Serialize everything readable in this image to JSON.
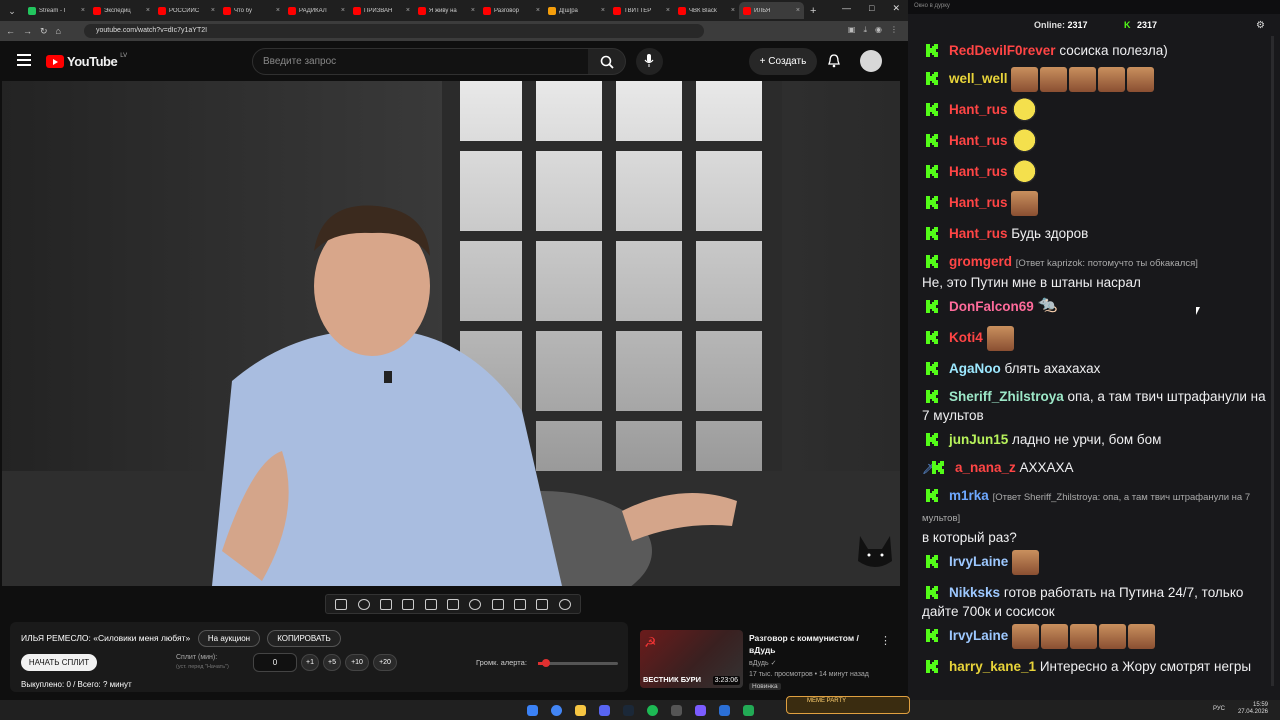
{
  "tabs": [
    {
      "label": "Stream - I",
      "color": "#22c55e",
      "active": false
    },
    {
      "label": "Экспедиц",
      "color": "#ff0000",
      "active": false
    },
    {
      "label": "РОССИЙС",
      "color": "#ff0000",
      "active": false
    },
    {
      "label": "Что бу",
      "color": "#ff0000",
      "active": false
    },
    {
      "label": "РАДИКАЛ",
      "color": "#ff0000",
      "active": false
    },
    {
      "label": "ПРИЗВАН",
      "color": "#ff0000",
      "active": false
    },
    {
      "label": "Я живу на",
      "color": "#ff0000",
      "active": false
    },
    {
      "label": "Разговор",
      "color": "#ff0000",
      "active": false
    },
    {
      "label": "Д[ш]ра",
      "color": "#f59e0b",
      "active": false
    },
    {
      "label": "ТВИТТЕР",
      "color": "#ff0000",
      "active": false
    },
    {
      "label": "ЧВК Black",
      "color": "#ff0000",
      "active": false
    },
    {
      "label": "ИЛЬЯ",
      "color": "#ff0000",
      "active": true
    }
  ],
  "url": "youtube.com/watch?v=dIc7y1aYT2I",
  "yt": {
    "logo_text": "YouTube",
    "region": "LV",
    "search_placeholder": "Введите запрос",
    "create_label": "Создать"
  },
  "panel": {
    "title": "ИЛЬЯ РЕМЕСЛО: «Силовики меня любят»",
    "auction_label": "На аукцион",
    "copy_label": "КОПИРОВАТЬ",
    "start_split_label": "НАЧАТЬ СПЛИТ",
    "split_label": "Сплит (мин):",
    "split_sub": "(уст. перед \"Начать\")",
    "split_value": "0",
    "inc": [
      "+1",
      "+5",
      "+10",
      "+20"
    ],
    "volume_label": "Громк. алерта:",
    "volume_level": 0.1,
    "sold_text": "Выкуплено: 0 / Всего: ? минут"
  },
  "recommend": {
    "title": "Разговор с коммунистом / вДудь",
    "channel": "вДудь",
    "stats": "17 тыс. просмотров • 14 минут назад",
    "badge": "Новинка",
    "thumb_caption": "ВЕСТНИК БУРИ",
    "duration": "3:23:06"
  },
  "chat": {
    "window_title": "Окно в дурку",
    "online_label": "Online:",
    "online_count": "2317",
    "viewer_count": "2317",
    "messages": [
      {
        "user": "RedDevilF0rever",
        "color": "#ff4545",
        "text": "сосиска полезла)",
        "emotes": []
      },
      {
        "user": "well_well",
        "color": "#e8d43a",
        "text": "",
        "emotes": [
          "face",
          "face",
          "face",
          "face",
          "face"
        ]
      },
      {
        "user": "Hant_rus",
        "color": "#ff4545",
        "text": "",
        "emotes": [
          "bee"
        ]
      },
      {
        "user": "Hant_rus",
        "color": "#ff4545",
        "text": "",
        "emotes": [
          "bee"
        ]
      },
      {
        "user": "Hant_rus",
        "color": "#ff4545",
        "text": "",
        "emotes": [
          "bee"
        ]
      },
      {
        "user": "Hant_rus",
        "color": "#ff4545",
        "text": "",
        "emotes": [
          "face"
        ]
      },
      {
        "user": "Hant_rus",
        "color": "#ff4545",
        "text": "Будь здоров",
        "emotes": []
      },
      {
        "user": "gromgerd",
        "color": "#ff4545",
        "reply": "[Ответ kaprizok: потомучто ты обкакался]",
        "text": "Не, это Путин мне в штаны насрал",
        "emotes": []
      },
      {
        "user": "DonFalcon69",
        "color": "#ff6b9b",
        "text": "",
        "emotes": [
          "mouse"
        ]
      },
      {
        "user": "Koti4",
        "color": "#ff4545",
        "text": "",
        "emotes": [
          "face"
        ]
      },
      {
        "user": "AgaNoo",
        "color": "#9de8ff",
        "text": "блять ахахахах",
        "emotes": []
      },
      {
        "user": "Sheriff_Zhilstroya",
        "color": "#9de8c8",
        "text": "опа, а там твич штрафанули на 7 мультов",
        "emotes": []
      },
      {
        "user": "junJun15",
        "color": "#b7f25b",
        "text": "ладно не урчи, бом бом",
        "emotes": []
      },
      {
        "user": "a_nana_z",
        "color": "#ff4545",
        "text": "АХХАХА",
        "emotes": [],
        "sword": true
      },
      {
        "user": "m1rka",
        "color": "#6ea8ff",
        "reply": "[Ответ Sheriff_Zhilstroya: опа, а там твич штрафанули на 7 мультов]",
        "text": "в который раз?",
        "emotes": []
      },
      {
        "user": "IrvyLaine",
        "color": "#9dc8ff",
        "text": "",
        "emotes": [
          "face"
        ]
      },
      {
        "user": "Nikksks",
        "color": "#9dc8ff",
        "text": "готов работать на Путина 24/7, только дайте 700к и сосисок",
        "emotes": []
      },
      {
        "user": "IrvyLaine",
        "color": "#9dc8ff",
        "text": "",
        "emotes": [
          "face",
          "face",
          "face",
          "face",
          "face"
        ]
      },
      {
        "user": "harry_kane_1",
        "color": "#e8d43a",
        "text": "Интересно а Жору смотрят негры",
        "emotes": []
      }
    ]
  },
  "taskbar": {
    "meme_party": "MEME PARTY",
    "lang": "РУС",
    "time": "15:59",
    "date": "27.04.2026"
  }
}
